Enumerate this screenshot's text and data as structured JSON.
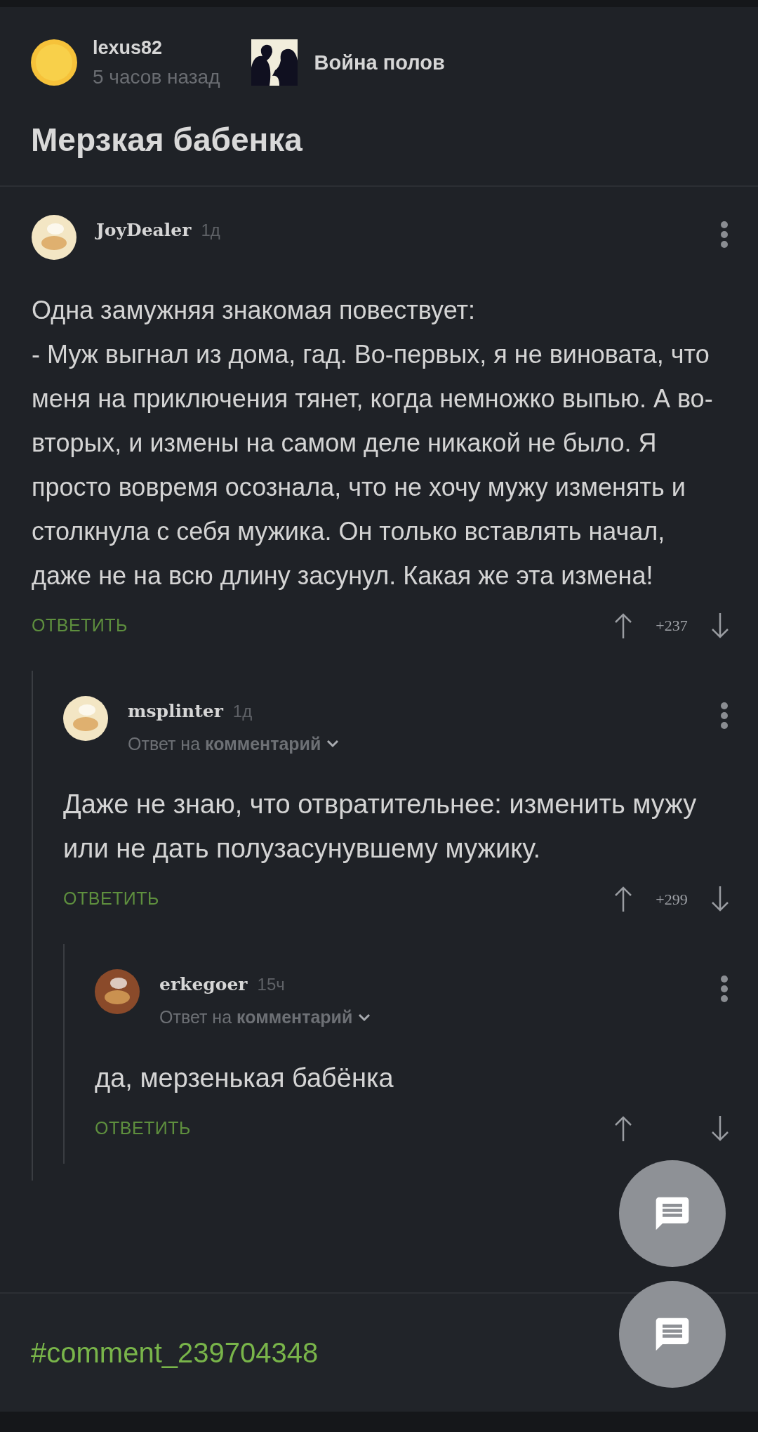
{
  "post": {
    "author": "lexus82",
    "time": "5 часов назад",
    "community": "Война полов",
    "title": "Мерзкая бабенка"
  },
  "comments": [
    {
      "author": "JoyDealer",
      "time": "1д",
      "color": "#f3e6c4",
      "text": "Одна замужняя знакомая повествует:\n- Муж выгнал из дома, гад. Во-первых, я не виновата, что меня на приключения тянет, когда немножко выпью. А во-вторых, и измены на самом деле никакой не было. Я просто вовремя осознала, что не хочу мужу изменять и столкнула с себя мужика. Он только вставлять начал, даже не на всю длину засунул. Какая же эта измена!",
      "reply": "ОТВЕТИТЬ",
      "score": "+237",
      "children": [
        {
          "author": "msplinter",
          "time": "1д",
          "color": "#f3e6c4",
          "reply_to": "Ответ на **комментарий**",
          "text": "Даже не знаю, что отвратительнее: изменить мужу или не дать полузасунувшему мужику.",
          "reply": "ОТВЕТИТЬ",
          "score": "+299",
          "children": [
            {
              "author": "erkegoer",
              "time": "15ч",
              "color": "#8a4a2a",
              "reply_to": "Ответ на **комментарий**",
              "text": "да, мерзенькая бабёнка",
              "reply": "ОТВЕТИТЬ"
            }
          ]
        }
      ]
    }
  ],
  "hashtag": "#comment_239704348"
}
